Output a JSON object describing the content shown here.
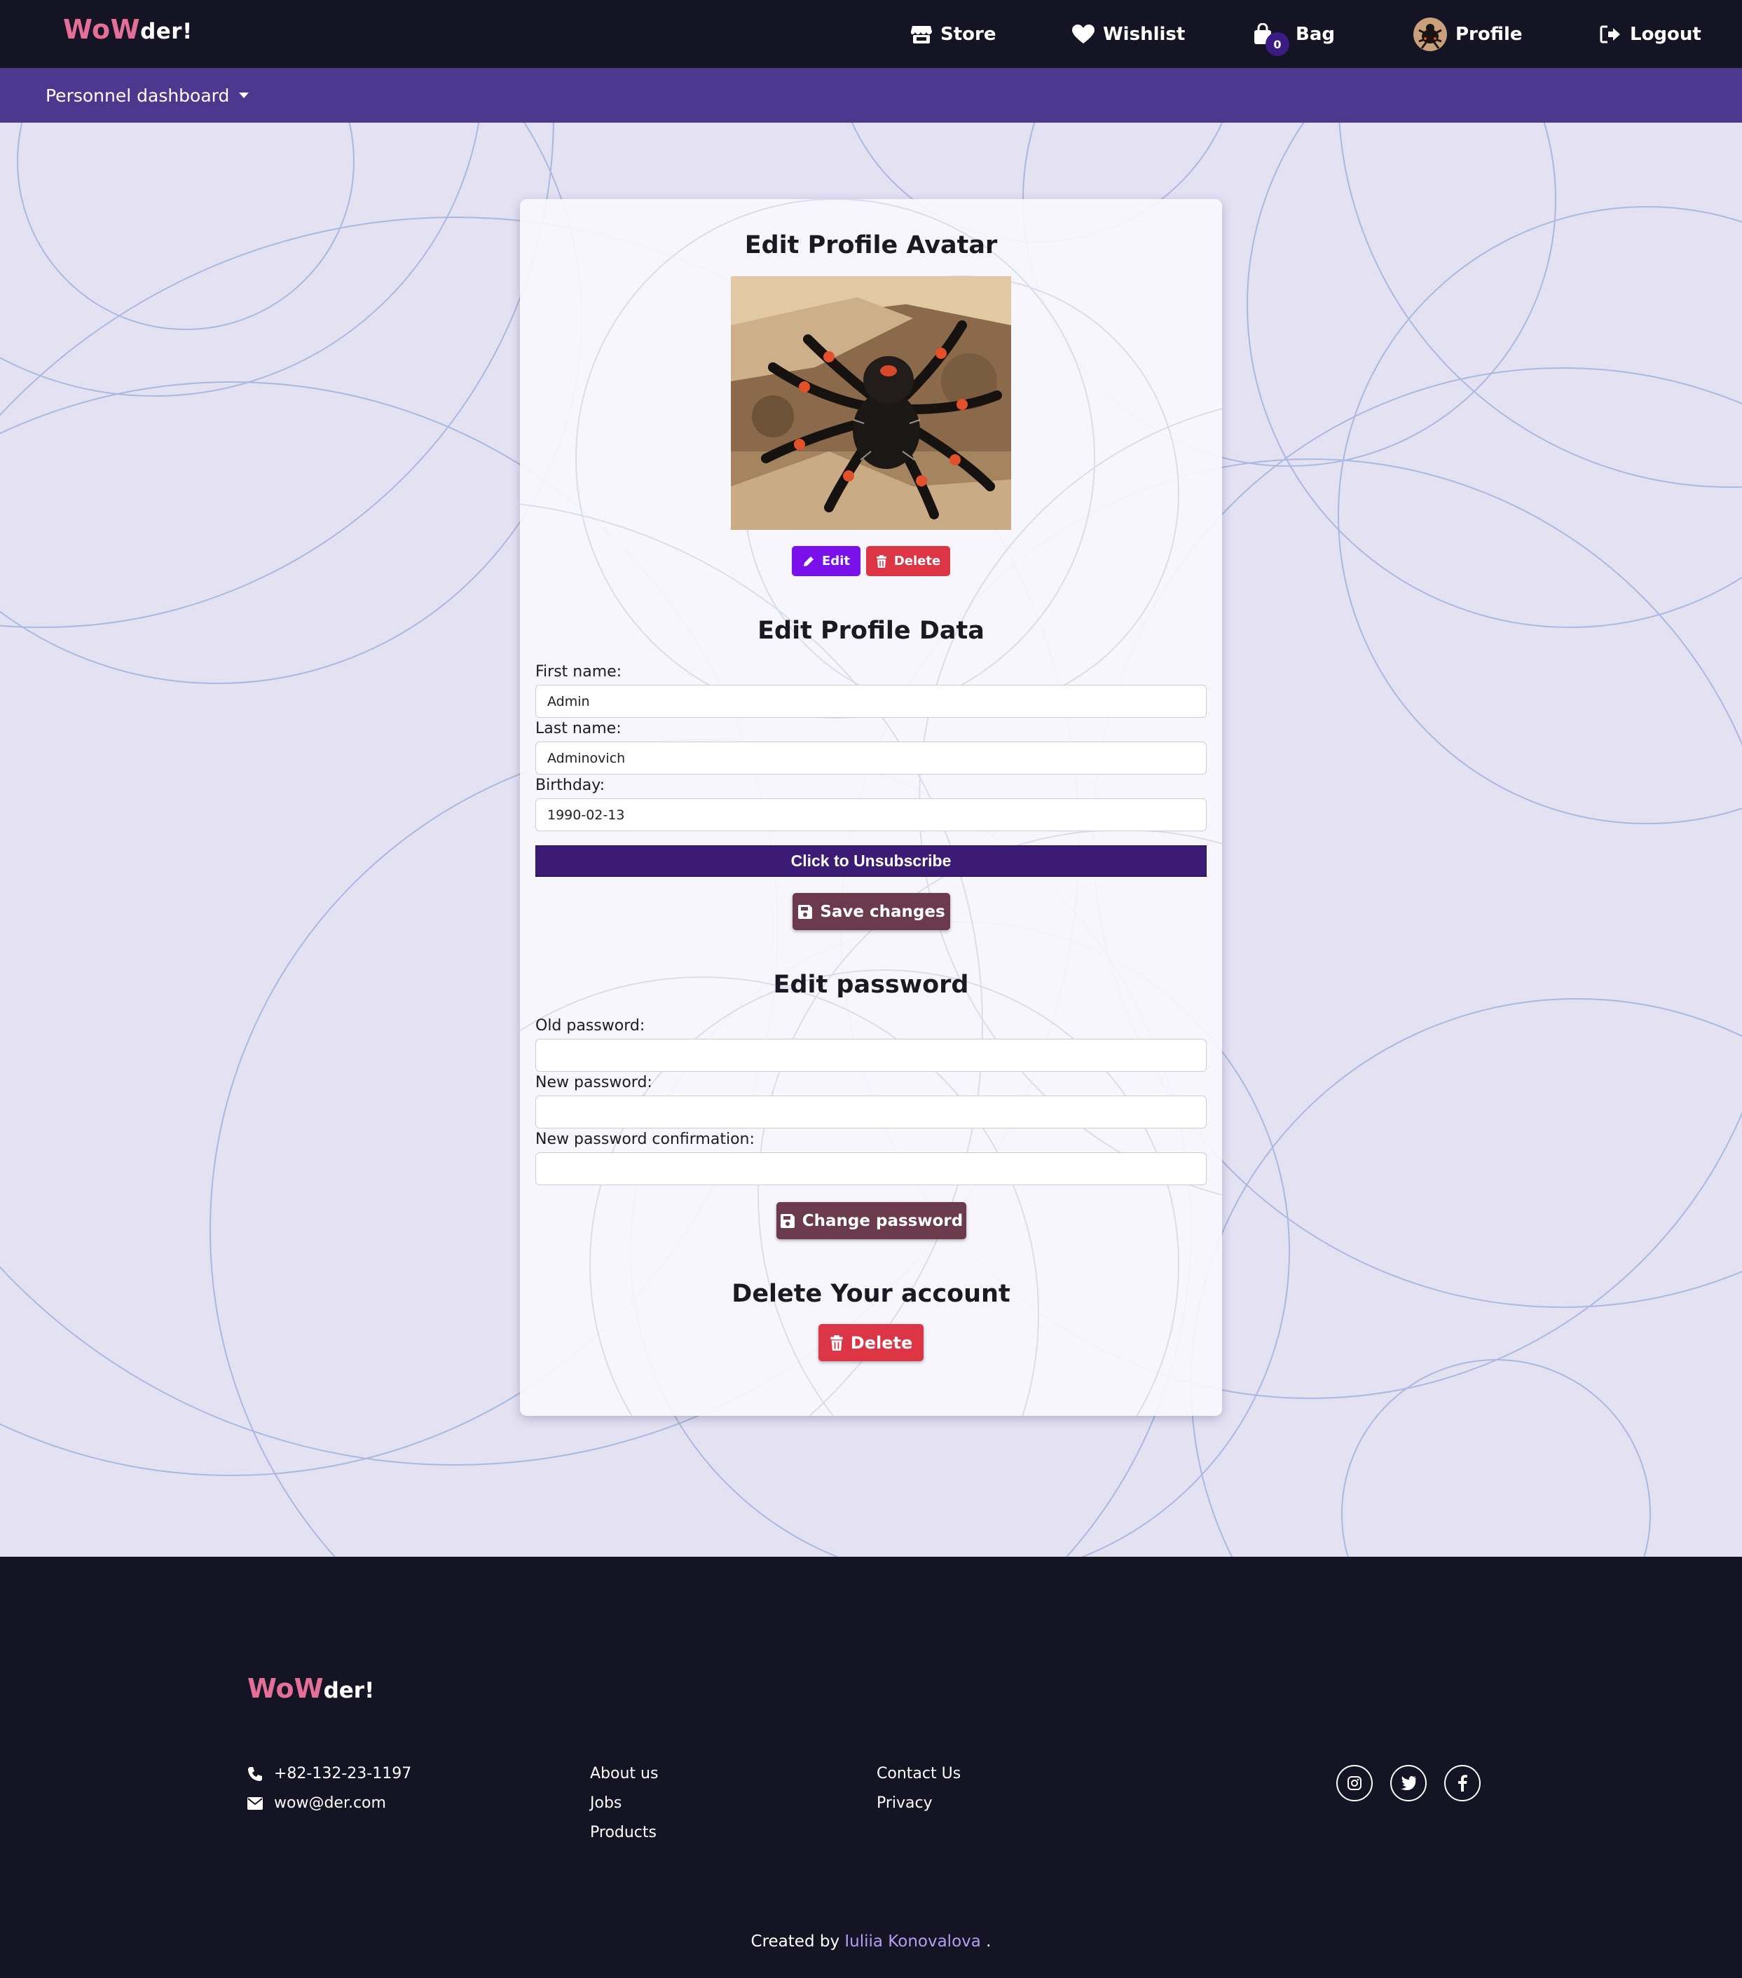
{
  "brand": {
    "part1": "WoW",
    "part2": "der!"
  },
  "nav": {
    "store": "Store",
    "wishlist": "Wishlist",
    "bag": "Bag",
    "bag_count": "0",
    "profile": "Profile",
    "logout": "Logout"
  },
  "subnav": {
    "dashboard": "Personnel dashboard"
  },
  "avatar_section": {
    "title": "Edit Profile Avatar",
    "edit_label": "Edit",
    "delete_label": "Delete"
  },
  "profile_section": {
    "title": "Edit Profile Data",
    "first_name_label": "First name:",
    "first_name_value": "Admin",
    "last_name_label": "Last name:",
    "last_name_value": "Adminovich",
    "birthday_label": "Birthday:",
    "birthday_value": "1990-02-13",
    "unsubscribe_label": "Click to Unsubscribe",
    "save_label": "Save changes"
  },
  "password_section": {
    "title": "Edit password",
    "old_label": "Old password:",
    "new_label": "New password:",
    "confirm_label": "New password confirmation:",
    "change_label": "Change password"
  },
  "delete_section": {
    "title": "Delete Your account",
    "delete_label": "Delete"
  },
  "footer": {
    "phone": "+82-132-23-1197",
    "email": "wow@der.com",
    "links_col1": [
      "About us",
      "Jobs",
      "Products"
    ],
    "links_col2": [
      "Contact Us",
      "Privacy"
    ],
    "social": [
      "instagram-icon",
      "twitter-icon",
      "facebook-icon"
    ],
    "credits_prefix": "Created by",
    "credits_author": "Iuliia Konovalova",
    "credits_suffix": "."
  },
  "colors": {
    "navbar": "#151424",
    "subbar": "#4e378e",
    "background": "#e4e1f3",
    "brand_pink": "#e46f98",
    "edit_purple": "#7a10ea",
    "danger_red": "#dc3545",
    "unsubscribe": "#3b1b74",
    "save_button": "#6b3a4c",
    "credits_link": "#b89cf0"
  }
}
